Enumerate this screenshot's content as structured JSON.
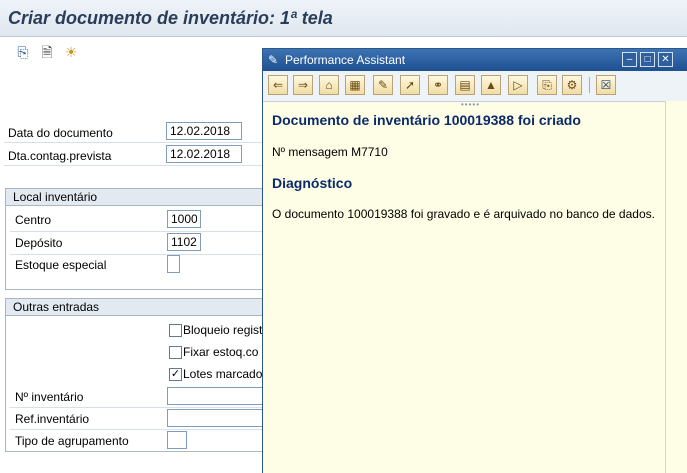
{
  "window": {
    "title": "Criar documento de inventário: 1ª tela"
  },
  "toolbar": {
    "icons": [
      "print-icon",
      "new-document-icon",
      "tips-icon"
    ]
  },
  "header_fields": {
    "doc_date": {
      "label": "Data do documento",
      "value": "12.02.2018"
    },
    "planned_count_date": {
      "label": "Dta.contag.prevista",
      "value": "12.02.2018"
    }
  },
  "local_group": {
    "title": "Local inventário",
    "plant": {
      "label": "Centro",
      "value": "1000"
    },
    "storage_location": {
      "label": "Depósito",
      "value": "1102"
    },
    "special_stock": {
      "label": "Estoque especial",
      "value": ""
    }
  },
  "other_group": {
    "title": "Outras entradas",
    "check_block": {
      "label": "Bloqueio regist",
      "checked": false
    },
    "check_freeze": {
      "label": "Fixar estoq.co",
      "checked": false
    },
    "check_batches": {
      "label": "Lotes marcado",
      "checked": true
    },
    "inventory_no": {
      "label": "Nº inventário",
      "value": ""
    },
    "inventory_ref": {
      "label": "Ref.inventário",
      "value": ""
    },
    "grouping_type": {
      "label": "Tipo de agrupamento",
      "value": ""
    }
  },
  "assistant": {
    "title": "Performance Assistant",
    "heading": "Documento de inventário 100019388 foi criado",
    "message_no": "Nº mensagem M7710",
    "diag_heading": "Diagnóstico",
    "diag_text": "O documento 100019388 foi gravado e é arquivado no banco de dados.",
    "toolbar_icons": [
      "back-icon",
      "forward-icon",
      "home-icon",
      "structure-icon",
      "edit-icon",
      "technical-info-icon",
      "key-icon",
      "document-icon",
      "note-icon",
      "export-icon",
      "print-icon",
      "settings-icon",
      "close-icon"
    ]
  },
  "colors": {
    "title_text": "#2a3d59",
    "assistant_bg": "#fefee6",
    "assistant_titlebar": "#1f5091",
    "heading": "#0b2a6b"
  }
}
